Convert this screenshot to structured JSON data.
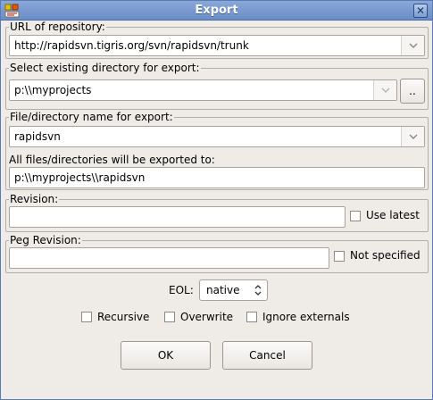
{
  "window": {
    "title": "Export",
    "close_glyph": "✕",
    "icon": "rapidsvn-app-icon",
    "accent": "#6a8cc6"
  },
  "url_group": {
    "label": "URL of repository:",
    "value": "http://rapidsvn.tigris.org/svn/rapidsvn/trunk"
  },
  "dir_group": {
    "label": "Select existing directory for export:",
    "value": "p:\\\\myprojects",
    "browse_label": ".."
  },
  "name_group": {
    "label": "File/directory name for export:",
    "value": "rapidsvn",
    "dest_label": "All files/directories will be exported to:",
    "dest_value": "p:\\\\myprojects\\\\rapidsvn"
  },
  "revision_group": {
    "label": "Revision:",
    "value": "",
    "use_latest_label": "Use latest",
    "use_latest_checked": false
  },
  "peg_group": {
    "label": "Peg Revision:",
    "value": "",
    "not_specified_label": "Not specified",
    "not_specified_checked": false
  },
  "eol": {
    "label": "EOL:",
    "value": "native"
  },
  "options": {
    "recursive_label": "Recursive",
    "overwrite_label": "Overwrite",
    "ignore_externals_label": "Ignore externals"
  },
  "buttons": {
    "ok_label": "OK",
    "cancel_label": "Cancel"
  }
}
